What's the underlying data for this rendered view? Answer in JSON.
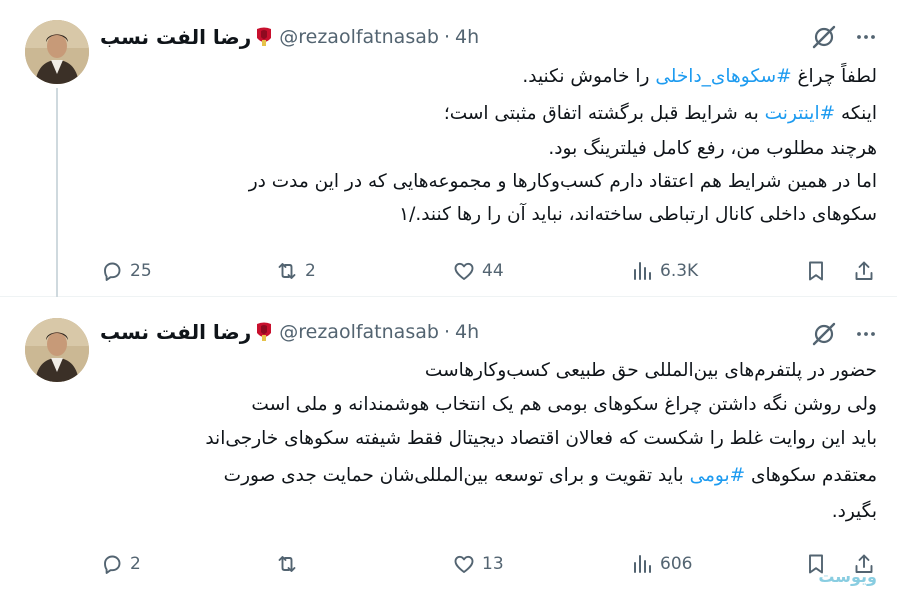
{
  "colors": {
    "text": "#0f1419",
    "secondary": "#536471",
    "hashtag": "#1d9bf0",
    "divider": "#eff3f4",
    "badge": "#c8102e"
  },
  "tweets": [
    {
      "display_name": "رضا الفت نسب",
      "handle": "@rezaolfatnasab",
      "separator": "·",
      "time": "4h",
      "lines": [
        {
          "before": "لطفاً چراغ ",
          "tag": "#سکوهای_داخلی",
          "after": " را خاموش نکنید."
        },
        {
          "before": "اینکه ",
          "tag": "#اینترنت",
          "after": " به شرایط قبل برگشته اتفاق مثبتی است؛"
        },
        {
          "text": "هرچند مطلوب من، رفع کامل فیلترینگ بود."
        },
        {
          "text": "اما در همین شرایط هم اعتقاد دارم کسب‌وکارها و مجموعه‌هایی که در این مدت در"
        },
        {
          "text": "سکوهای داخلی کانال ارتباطی ساخته‌اند، نباید آن را رها کنند./۱"
        }
      ],
      "stats": {
        "replies": "25",
        "reposts": "2",
        "likes": "44",
        "views": "6.3K"
      }
    },
    {
      "display_name": "رضا الفت نسب",
      "handle": "@rezaolfatnasab",
      "separator": "·",
      "time": "4h",
      "lines": [
        {
          "text": "حضور در پلتفرم‌های بین‌المللی حق طبیعی کسب‌وکارهاست"
        },
        {
          "text": "ولی روشن نگه داشتن چراغ سکوهای بومی هم یک انتخاب هوشمندانه و ملی است"
        },
        {
          "text": "باید این روایت غلط را شکست که فعالان اقتصاد دیجیتال فقط شیفته سکوهای خارجی‌اند"
        },
        {
          "before": "معتقدم سکوهای ",
          "tag": "#بومی",
          "after": " باید تقویت و برای توسعه بین‌المللی‌شان حمایت جدی صورت"
        },
        {
          "text": "بگیرد."
        }
      ],
      "stats": {
        "replies": "2",
        "reposts": "",
        "likes": "13",
        "views": "606"
      }
    }
  ],
  "icons": {
    "badge": "red-ribbon-icon",
    "grok": "grok-icon",
    "more": "more-icon",
    "reply": "reply-icon",
    "repost": "repost-icon",
    "like": "heart-icon",
    "views": "views-icon",
    "bookmark": "bookmark-icon",
    "share": "share-icon"
  },
  "watermark": "ویوست"
}
